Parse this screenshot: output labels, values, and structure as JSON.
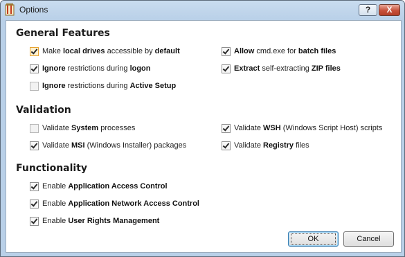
{
  "window": {
    "title": "Options",
    "help_label": "?",
    "close_label": "X"
  },
  "sections": {
    "general": {
      "title": "General Features",
      "items": {
        "local_drives": {
          "checked": true,
          "parts": [
            [
              "Make ",
              false
            ],
            [
              "local drives",
              true
            ],
            [
              " accessible by ",
              false
            ],
            [
              "default",
              true
            ]
          ]
        },
        "logon": {
          "checked": true,
          "parts": [
            [
              "Ignore",
              true
            ],
            [
              " restrictions during ",
              false
            ],
            [
              "logon",
              true
            ]
          ]
        },
        "active_setup": {
          "checked": false,
          "parts": [
            [
              "Ignore",
              true
            ],
            [
              " restrictions during ",
              false
            ],
            [
              "Active Setup",
              true
            ]
          ]
        },
        "cmd_exe": {
          "checked": true,
          "parts": [
            [
              "Allow",
              true
            ],
            [
              " cmd.exe for ",
              false
            ],
            [
              "batch files",
              true
            ]
          ]
        },
        "zip_files": {
          "checked": true,
          "parts": [
            [
              "Extract",
              true
            ],
            [
              " self-extracting ",
              false
            ],
            [
              "ZIP files",
              true
            ]
          ]
        }
      }
    },
    "validation": {
      "title": "Validation",
      "items": {
        "system": {
          "checked": false,
          "parts": [
            [
              "Validate ",
              false
            ],
            [
              "System",
              true
            ],
            [
              " processes",
              false
            ]
          ]
        },
        "msi": {
          "checked": true,
          "parts": [
            [
              "Validate ",
              false
            ],
            [
              "MSI",
              true
            ],
            [
              " (Windows Installer) packages",
              false
            ]
          ]
        },
        "wsh": {
          "checked": true,
          "parts": [
            [
              "Validate ",
              false
            ],
            [
              "WSH",
              true
            ],
            [
              " (Windows Script Host) scripts",
              false
            ]
          ]
        },
        "registry": {
          "checked": true,
          "parts": [
            [
              "Validate ",
              false
            ],
            [
              "Registry",
              true
            ],
            [
              " files",
              false
            ]
          ]
        }
      }
    },
    "functionality": {
      "title": "Functionality",
      "items": {
        "app_access": {
          "checked": true,
          "parts": [
            [
              "Enable ",
              false
            ],
            [
              "Application Access Control",
              true
            ]
          ]
        },
        "network_access": {
          "checked": true,
          "parts": [
            [
              "Enable ",
              false
            ],
            [
              "Application Network Access Control",
              true
            ]
          ]
        },
        "user_rights": {
          "checked": true,
          "parts": [
            [
              "Enable ",
              false
            ],
            [
              "User Rights Management",
              true
            ]
          ]
        }
      }
    }
  },
  "buttons": {
    "ok": "OK",
    "cancel": "Cancel"
  },
  "colors": {
    "titlebar": "#c9dcef",
    "close_button": "#c7503a",
    "default_button_border": "#3c7fb1",
    "hover_checkbox": "#e8a432"
  },
  "icons": {
    "app": "wrench-document-icon",
    "help": "question-icon",
    "close": "close-icon"
  }
}
